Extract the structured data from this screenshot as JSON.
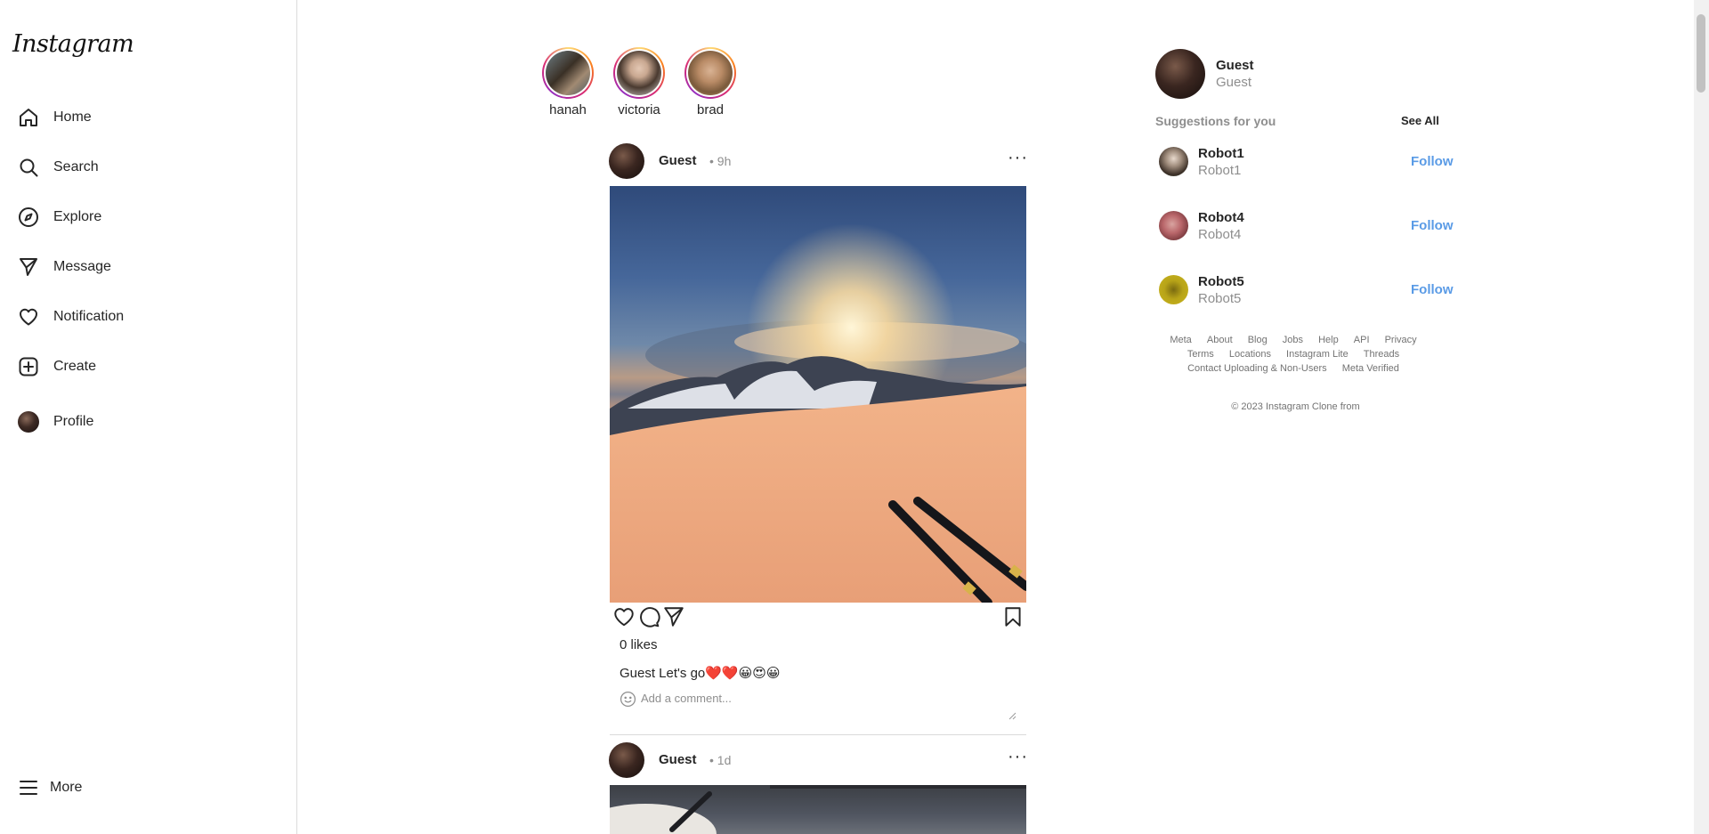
{
  "app": {
    "logo": "Instagram"
  },
  "sidebar": {
    "items": [
      {
        "label": "Home",
        "icon": "home-icon"
      },
      {
        "label": "Search",
        "icon": "search-icon"
      },
      {
        "label": "Explore",
        "icon": "compass-icon"
      },
      {
        "label": "Message",
        "icon": "send-icon"
      },
      {
        "label": "Notification",
        "icon": "heart-icon"
      },
      {
        "label": "Create",
        "icon": "plus-square-icon"
      },
      {
        "label": "Profile",
        "icon": "avatar-icon"
      }
    ],
    "more": {
      "label": "More",
      "icon": "menu-icon"
    }
  },
  "stories": [
    {
      "name": "hanah"
    },
    {
      "name": "victoria"
    },
    {
      "name": "brad"
    }
  ],
  "posts": [
    {
      "user": "Guest",
      "time": "• 9h",
      "likes": "0 likes",
      "caption": "Guest Let's go❤️❤️😀😍😀",
      "comment_placeholder": "Add a comment..."
    },
    {
      "user": "Guest",
      "time": "• 1d"
    }
  ],
  "right": {
    "me": {
      "username": "Guest",
      "name": "Guest"
    },
    "suggestions_title": "Suggestions for you",
    "see_all": "See All",
    "suggestions": [
      {
        "username": "Robot1",
        "name": "Robot1",
        "action": "Follow"
      },
      {
        "username": "Robot4",
        "name": "Robot4",
        "action": "Follow"
      },
      {
        "username": "Robot5",
        "name": "Robot5",
        "action": "Follow"
      }
    ],
    "footer_links": [
      "Meta",
      "About",
      "Blog",
      "Jobs",
      "Help",
      "API",
      "Privacy",
      "Terms",
      "Locations",
      "Instagram Lite",
      "Threads",
      "Contact Uploading & Non-Users",
      "Meta Verified"
    ],
    "copyright": "© 2023 Instagram Clone from"
  },
  "colors": {
    "follow": "#5a9be6",
    "muted": "#8e8e8e",
    "text": "#262626",
    "border": "#dbdbdb"
  }
}
